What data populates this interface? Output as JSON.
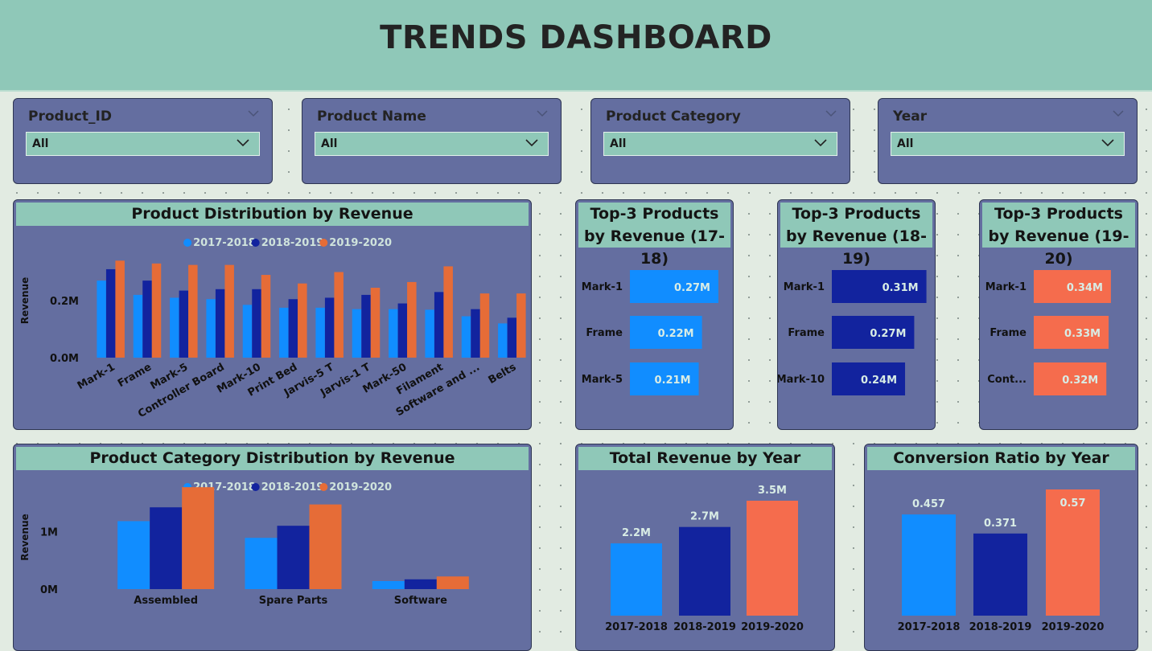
{
  "header": {
    "title": "TRENDS DASHBOARD"
  },
  "colors": {
    "y1718": "#118dff",
    "y1819": "#12239e",
    "y1920_clustered": "#e66c37",
    "y1920_top3": "#f56c4d",
    "panel": "#646ea0",
    "accent": "#8fc8b8"
  },
  "slicers": [
    {
      "title": "Product_ID",
      "value": "All",
      "icon": "chevron-down-icon"
    },
    {
      "title": "Product Name",
      "value": "All",
      "icon": "chevron-down-icon"
    },
    {
      "title": "Product Category",
      "value": "All",
      "icon": "chevron-down-icon"
    },
    {
      "title": "Year",
      "value": "All",
      "icon": "chevron-down-icon"
    }
  ],
  "legend": [
    "2017-2018",
    "2018-2019",
    "2019-2020"
  ],
  "product_chart": {
    "title": "Product Distribution by Revenue"
  },
  "category_chart": {
    "title": "Product Category Distribution by Revenue"
  },
  "top3_1718": {
    "title": "Top-3 Products by Revenue (17-18)"
  },
  "top3_1819": {
    "title": "Top-3 Products by Revenue (18-19)"
  },
  "top3_1920": {
    "title": "Top-3 Products by Revenue (19-20)"
  },
  "total_revenue": {
    "title": "Total Revenue by Year"
  },
  "conversion": {
    "title": "Conversion Ratio by Year"
  },
  "chart_data": [
    {
      "type": "bar",
      "title": "Product Distribution by Revenue",
      "ylabel": "Revenue",
      "ylim": [
        0,
        0.4
      ],
      "yticks": [
        "0.0M",
        "0.2M"
      ],
      "categories": [
        "Mark-1",
        "Frame",
        "Mark-5",
        "Controller Board",
        "Mark-10",
        "Print Bed",
        "Jarvis-5 T",
        "Jarvis-1 T",
        "Mark-50",
        "Filament",
        "Software and ...",
        "Belts"
      ],
      "series": [
        {
          "name": "2017-2018",
          "values": [
            0.27,
            0.22,
            0.21,
            0.205,
            0.185,
            0.175,
            0.175,
            0.17,
            0.17,
            0.168,
            0.145,
            0.12
          ]
        },
        {
          "name": "2018-2019",
          "values": [
            0.31,
            0.27,
            0.235,
            0.24,
            0.24,
            0.205,
            0.21,
            0.22,
            0.19,
            0.23,
            0.17,
            0.14
          ]
        },
        {
          "name": "2019-2020",
          "values": [
            0.34,
            0.33,
            0.325,
            0.325,
            0.29,
            0.26,
            0.3,
            0.245,
            0.265,
            0.32,
            0.225,
            0.225
          ]
        }
      ],
      "legend": "top-center",
      "grid": false
    },
    {
      "type": "bar",
      "title": "Product Category Distribution by Revenue",
      "ylabel": "Revenue",
      "ylim": [
        0,
        1.8
      ],
      "yticks": [
        "0M",
        "1M"
      ],
      "categories": [
        "Assembled",
        "Spare Parts",
        "Software"
      ],
      "series": [
        {
          "name": "2017-2018",
          "values": [
            1.18,
            0.89,
            0.14
          ]
        },
        {
          "name": "2018-2019",
          "values": [
            1.42,
            1.1,
            0.17
          ]
        },
        {
          "name": "2019-2020",
          "values": [
            1.77,
            1.47,
            0.22
          ]
        }
      ],
      "legend": "top-center",
      "grid": false
    },
    {
      "type": "bar",
      "orientation": "horizontal",
      "title": "Top-3 Products by Revenue (17-18)",
      "categories": [
        "Mark-1",
        "Frame",
        "Mark-5"
      ],
      "values": [
        0.27,
        0.22,
        0.21
      ],
      "labels": [
        "0.27M",
        "0.22M",
        "0.21M"
      ],
      "color": "#118dff"
    },
    {
      "type": "bar",
      "orientation": "horizontal",
      "title": "Top-3 Products by Revenue (18-19)",
      "categories": [
        "Mark-1",
        "Frame",
        "Mark-10"
      ],
      "values": [
        0.31,
        0.27,
        0.24
      ],
      "labels": [
        "0.31M",
        "0.27M",
        "0.24M"
      ],
      "color": "#12239e"
    },
    {
      "type": "bar",
      "orientation": "horizontal",
      "title": "Top-3 Products by Revenue (19-20)",
      "categories": [
        "Mark-1",
        "Frame",
        "Cont..."
      ],
      "values": [
        0.34,
        0.33,
        0.32
      ],
      "labels": [
        "0.34M",
        "0.33M",
        "0.32M"
      ],
      "color": "#f56c4d"
    },
    {
      "type": "bar",
      "title": "Total Revenue by Year",
      "categories": [
        "2017-2018",
        "2018-2019",
        "2019-2020"
      ],
      "values": [
        2.2,
        2.7,
        3.5
      ],
      "labels": [
        "2.2M",
        "2.7M",
        "3.5M"
      ],
      "colors": [
        "#118dff",
        "#12239e",
        "#f56c4d"
      ]
    },
    {
      "type": "bar",
      "title": "Conversion Ratio by Year",
      "categories": [
        "2017-2018",
        "2018-2019",
        "2019-2020"
      ],
      "values": [
        0.457,
        0.371,
        0.57
      ],
      "labels": [
        "0.457",
        "0.371",
        "0.57"
      ],
      "colors": [
        "#118dff",
        "#12239e",
        "#f56c4d"
      ]
    }
  ]
}
